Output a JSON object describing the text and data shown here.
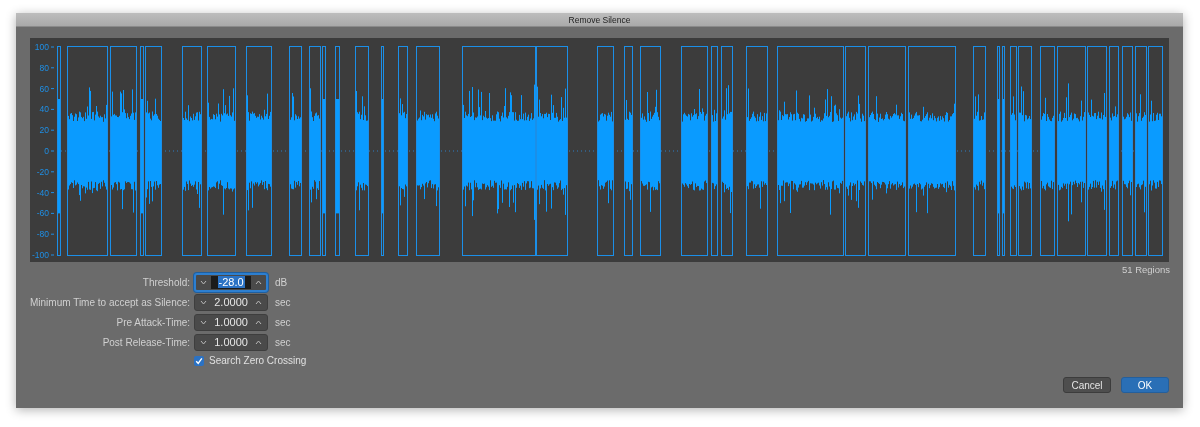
{
  "window": {
    "title": "Remove Silence"
  },
  "waveform": {
    "y_axis_labels": [
      "100",
      "80",
      "60",
      "40",
      "20",
      "0",
      "-20",
      "-40",
      "-60",
      "-80",
      "-100"
    ]
  },
  "region_count": "51 Regions",
  "fields": [
    {
      "label": "Threshold:",
      "value": "-28.0",
      "unit": "dB",
      "focused": true
    },
    {
      "label": "Minimum Time to accept as Silence:",
      "value": "2.0000",
      "unit": "sec",
      "focused": false
    },
    {
      "label": "Pre Attack-Time:",
      "value": "1.0000",
      "unit": "sec",
      "focused": false
    },
    {
      "label": "Post Release-Time:",
      "value": "1.0000",
      "unit": "sec",
      "focused": false
    }
  ],
  "checkbox": {
    "label": "Search Zero Crossing",
    "checked": true
  },
  "buttons": [
    {
      "label": "Cancel",
      "kind": "normal"
    },
    {
      "label": "OK",
      "kind": "default"
    }
  ]
}
